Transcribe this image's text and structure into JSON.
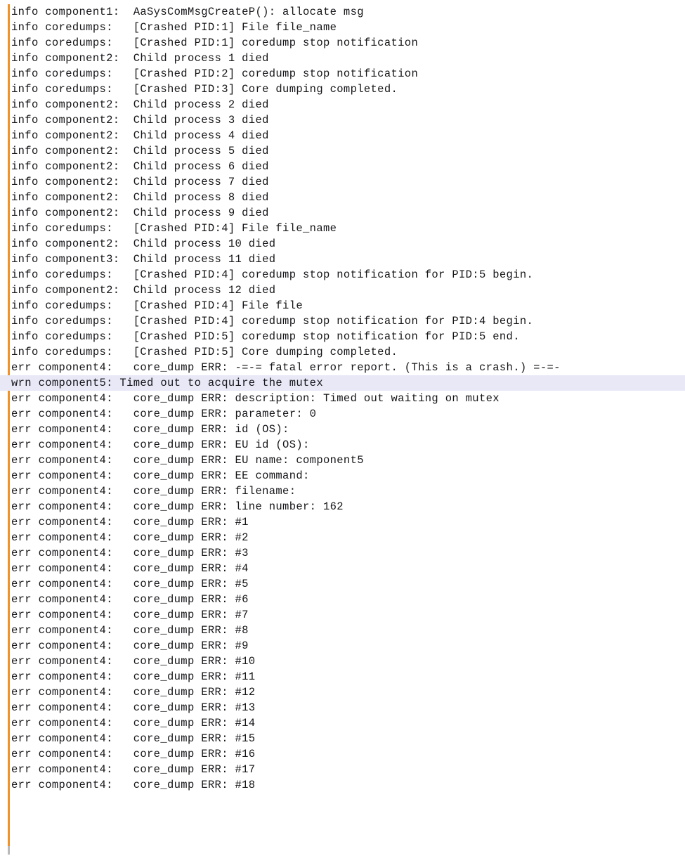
{
  "viewer": {
    "title": "Log Viewer",
    "accent_color": "#f0922b",
    "selection_color": "#e8e8f7",
    "text_color": "#16161a",
    "background_color": "#ffffff",
    "selected_line_index": 26,
    "line_count": 56,
    "gutter_icon": "log-marker-rule"
  },
  "lines": [
    {
      "level": "info",
      "component": "component1",
      "message": "AaSysComMsgCreateP(): allocate msg",
      "text": "info component1:  AaSysComMsgCreateP(): allocate msg",
      "selected": false
    },
    {
      "level": "info",
      "component": "coredumps",
      "message": "[Crashed PID:1] File file_name",
      "text": "info coredumps:   [Crashed PID:1] File file_name",
      "selected": false
    },
    {
      "level": "info",
      "component": "coredumps",
      "message": "[Crashed PID:1] coredump stop notification",
      "text": "info coredumps:   [Crashed PID:1] coredump stop notification",
      "selected": false
    },
    {
      "level": "info",
      "component": "component2",
      "message": "Child process 1 died",
      "text": "info component2:  Child process 1 died",
      "selected": false
    },
    {
      "level": "info",
      "component": "coredumps",
      "message": "[Crashed PID:2] coredump stop notification",
      "text": "info coredumps:   [Crashed PID:2] coredump stop notification",
      "selected": false
    },
    {
      "level": "info",
      "component": "coredumps",
      "message": "[Crashed PID:3] Core dumping completed.",
      "text": "info coredumps:   [Crashed PID:3] Core dumping completed.",
      "selected": false
    },
    {
      "level": "info",
      "component": "component2",
      "message": "Child process 2 died",
      "text": "info component2:  Child process 2 died",
      "selected": false
    },
    {
      "level": "info",
      "component": "component2",
      "message": "Child process 3 died",
      "text": "info component2:  Child process 3 died",
      "selected": false
    },
    {
      "level": "info",
      "component": "component2",
      "message": "Child process 4 died",
      "text": "info component2:  Child process 4 died",
      "selected": false
    },
    {
      "level": "info",
      "component": "component2",
      "message": "Child process 5 died",
      "text": "info component2:  Child process 5 died",
      "selected": false
    },
    {
      "level": "info",
      "component": "component2",
      "message": "Child process 6 died",
      "text": "info component2:  Child process 6 died",
      "selected": false
    },
    {
      "level": "info",
      "component": "component2",
      "message": "Child process 7 died",
      "text": "info component2:  Child process 7 died",
      "selected": false
    },
    {
      "level": "info",
      "component": "component2",
      "message": "Child process 8 died",
      "text": "info component2:  Child process 8 died",
      "selected": false
    },
    {
      "level": "info",
      "component": "component2",
      "message": "Child process 9 died",
      "text": "info component2:  Child process 9 died",
      "selected": false
    },
    {
      "level": "info",
      "component": "coredumps",
      "message": "[Crashed PID:4] File file_name",
      "text": "info coredumps:   [Crashed PID:4] File file_name",
      "selected": false
    },
    {
      "level": "info",
      "component": "component2",
      "message": "Child process 10 died",
      "text": "info component2:  Child process 10 died",
      "selected": false
    },
    {
      "level": "info",
      "component": "component3",
      "message": "Child process 11 died",
      "text": "info component3:  Child process 11 died",
      "selected": false
    },
    {
      "level": "info",
      "component": "coredumps",
      "message": "[Crashed PID:4] coredump stop notification for PID:5 begin.",
      "text": "info coredumps:   [Crashed PID:4] coredump stop notification for PID:5 begin.",
      "selected": false
    },
    {
      "level": "info",
      "component": "component2",
      "message": "Child process 12 died",
      "text": "info component2:  Child process 12 died",
      "selected": false
    },
    {
      "level": "info",
      "component": "coredumps",
      "message": "[Crashed PID:4] File file",
      "text": "info coredumps:   [Crashed PID:4] File file",
      "selected": false
    },
    {
      "level": "info",
      "component": "coredumps",
      "message": "[Crashed PID:4] coredump stop notification for PID:4 begin.",
      "text": "info coredumps:   [Crashed PID:4] coredump stop notification for PID:4 begin.",
      "selected": false
    },
    {
      "level": "info",
      "component": "coredumps",
      "message": "[Crashed PID:5] coredump stop notification for PID:5 end.",
      "text": "info coredumps:   [Crashed PID:5] coredump stop notification for PID:5 end.",
      "selected": false
    },
    {
      "level": "info",
      "component": "coredumps",
      "message": "[Crashed PID:5] Core dumping completed.",
      "text": "info coredumps:   [Crashed PID:5] Core dumping completed.",
      "selected": false
    },
    {
      "level": "err",
      "component": "component4",
      "message": "core_dump ERR: -=-= fatal error report. (This is a crash.) =-=-",
      "text": "err component4:   core_dump ERR: -=-= fatal error report. (This is a crash.) =-=-",
      "selected": false
    },
    {
      "level": "wrn",
      "component": "component5",
      "message": "Timed out to acquire the mutex",
      "text": "wrn component5: Timed out to acquire the mutex",
      "selected": true
    },
    {
      "level": "err",
      "component": "component4",
      "message": "core_dump ERR: description: Timed out waiting on mutex",
      "text": "err component4:   core_dump ERR: description: Timed out waiting on mutex",
      "selected": false
    },
    {
      "level": "err",
      "component": "component4",
      "message": "core_dump ERR: parameter: 0",
      "text": "err component4:   core_dump ERR: parameter: 0",
      "selected": false
    },
    {
      "level": "err",
      "component": "component4",
      "message": "core_dump ERR: id (OS):",
      "text": "err component4:   core_dump ERR: id (OS):",
      "selected": false
    },
    {
      "level": "err",
      "component": "component4",
      "message": "core_dump ERR: EU id (OS):",
      "text": "err component4:   core_dump ERR: EU id (OS):",
      "selected": false
    },
    {
      "level": "err",
      "component": "component4",
      "message": "core_dump ERR: EU name: component5",
      "text": "err component4:   core_dump ERR: EU name: component5",
      "selected": false
    },
    {
      "level": "err",
      "component": "component4",
      "message": "core_dump ERR: EE command:",
      "text": "err component4:   core_dump ERR: EE command:",
      "selected": false
    },
    {
      "level": "err",
      "component": "component4",
      "message": "core_dump ERR: filename:",
      "text": "err component4:   core_dump ERR: filename:",
      "selected": false
    },
    {
      "level": "err",
      "component": "component4",
      "message": "core_dump ERR: line number: 162",
      "text": "err component4:   core_dump ERR: line number: 162",
      "selected": false
    },
    {
      "level": "err",
      "component": "component4",
      "message": "core_dump ERR: #1",
      "text": "err component4:   core_dump ERR: #1",
      "selected": false
    },
    {
      "level": "err",
      "component": "component4",
      "message": "core_dump ERR: #2",
      "text": "err component4:   core_dump ERR: #2",
      "selected": false
    },
    {
      "level": "err",
      "component": "component4",
      "message": "core_dump ERR: #3",
      "text": "err component4:   core_dump ERR: #3",
      "selected": false
    },
    {
      "level": "err",
      "component": "component4",
      "message": "core_dump ERR: #4",
      "text": "err component4:   core_dump ERR: #4",
      "selected": false
    },
    {
      "level": "err",
      "component": "component4",
      "message": "core_dump ERR: #5",
      "text": "err component4:   core_dump ERR: #5",
      "selected": false
    },
    {
      "level": "err",
      "component": "component4",
      "message": "core_dump ERR: #6",
      "text": "err component4:   core_dump ERR: #6",
      "selected": false
    },
    {
      "level": "err",
      "component": "component4",
      "message": "core_dump ERR: #7",
      "text": "err component4:   core_dump ERR: #7",
      "selected": false
    },
    {
      "level": "err",
      "component": "component4",
      "message": "core_dump ERR: #8",
      "text": "err component4:   core_dump ERR: #8",
      "selected": false
    },
    {
      "level": "err",
      "component": "component4",
      "message": "core_dump ERR: #9",
      "text": "err component4:   core_dump ERR: #9",
      "selected": false
    },
    {
      "level": "err",
      "component": "component4",
      "message": "core_dump ERR: #10",
      "text": "err component4:   core_dump ERR: #10",
      "selected": false
    },
    {
      "level": "err",
      "component": "component4",
      "message": "core_dump ERR: #11",
      "text": "err component4:   core_dump ERR: #11",
      "selected": false
    },
    {
      "level": "err",
      "component": "component4",
      "message": "core_dump ERR: #12",
      "text": "err component4:   core_dump ERR: #12",
      "selected": false
    },
    {
      "level": "err",
      "component": "component4",
      "message": "core_dump ERR: #13",
      "text": "err component4:   core_dump ERR: #13",
      "selected": false
    },
    {
      "level": "err",
      "component": "component4",
      "message": "core_dump ERR: #14",
      "text": "err component4:   core_dump ERR: #14",
      "selected": false
    },
    {
      "level": "err",
      "component": "component4",
      "message": "core_dump ERR: #15",
      "text": "err component4:   core_dump ERR: #15",
      "selected": false
    },
    {
      "level": "err",
      "component": "component4",
      "message": "core_dump ERR: #16",
      "text": "err component4:   core_dump ERR: #16",
      "selected": false
    },
    {
      "level": "err",
      "component": "component4",
      "message": "core_dump ERR: #17",
      "text": "err component4:   core_dump ERR: #17",
      "selected": false
    },
    {
      "level": "err",
      "component": "component4",
      "message": "core_dump ERR: #18",
      "text": "err component4:   core_dump ERR: #18",
      "selected": false
    }
  ]
}
